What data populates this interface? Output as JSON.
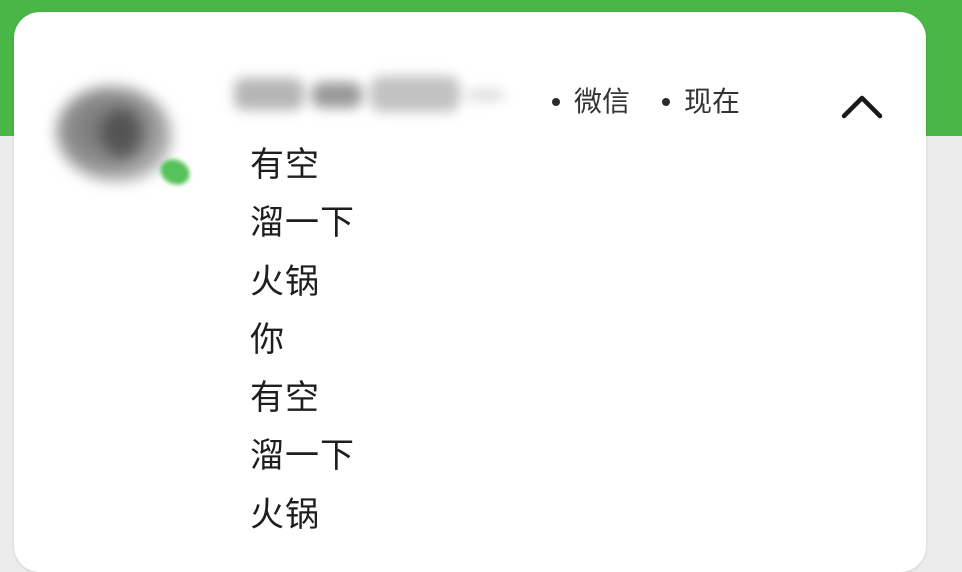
{
  "notification": {
    "app_name": "微信",
    "time": "现在",
    "messages": [
      "有空",
      "溜一下",
      "火锅",
      "你",
      "有空",
      "溜一下",
      "火锅"
    ]
  },
  "colors": {
    "top_band": "#4ab646",
    "card_background": "#ffffff",
    "page_background": "#ececec",
    "presence": "#55c25a",
    "text": "#1e1e1e"
  },
  "icons": {
    "collapse": "chevron-up-icon",
    "presence": "presence-dot-icon"
  }
}
